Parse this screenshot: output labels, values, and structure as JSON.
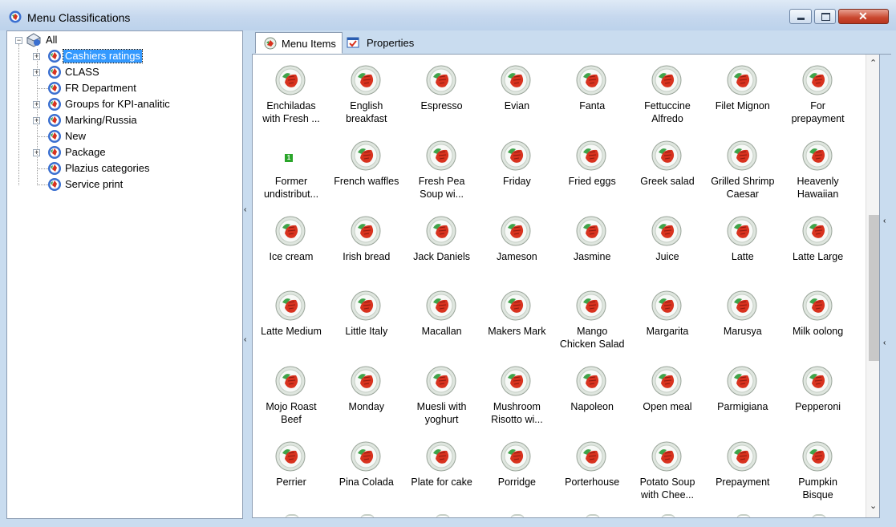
{
  "window": {
    "title": "Menu Classifications"
  },
  "tree": {
    "root": "All",
    "items": [
      {
        "label": "Cashiers ratings",
        "expandable": true,
        "selected": true
      },
      {
        "label": "CLASS",
        "expandable": true
      },
      {
        "label": "FR Department",
        "expandable": false
      },
      {
        "label": "Groups for KPI-analitic",
        "expandable": true
      },
      {
        "label": "Marking/Russia",
        "expandable": true
      },
      {
        "label": "New",
        "expandable": false
      },
      {
        "label": "Package",
        "expandable": true
      },
      {
        "label": "Plazius categories",
        "expandable": false
      },
      {
        "label": "Service print",
        "expandable": false
      }
    ]
  },
  "tabs": [
    {
      "label": "Menu Items",
      "active": true
    },
    {
      "label": "Properties",
      "active": false
    }
  ],
  "items": [
    {
      "label": "Enchiladas\nwith Fresh ..."
    },
    {
      "label": "English\nbreakfast"
    },
    {
      "label": "Espresso"
    },
    {
      "label": "Evian"
    },
    {
      "label": "Fanta"
    },
    {
      "label": "Fettuccine\nAlfredo"
    },
    {
      "label": "Filet Mignon"
    },
    {
      "label": "For\nprepayment"
    },
    {
      "label": "Former\nundistribut...",
      "noicon": true,
      "badge": "1"
    },
    {
      "label": "French waffles"
    },
    {
      "label": "Fresh Pea\nSoup wi..."
    },
    {
      "label": "Friday"
    },
    {
      "label": "Fried eggs"
    },
    {
      "label": "Greek salad"
    },
    {
      "label": "Grilled Shrimp\nCaesar"
    },
    {
      "label": "Heavenly\nHawaiian"
    },
    {
      "label": "Ice cream"
    },
    {
      "label": "Irish bread"
    },
    {
      "label": "Jack Daniels"
    },
    {
      "label": "Jameson"
    },
    {
      "label": "Jasmine"
    },
    {
      "label": "Juice"
    },
    {
      "label": "Latte"
    },
    {
      "label": "Latte Large"
    },
    {
      "label": "Latte Medium"
    },
    {
      "label": "Little Italy"
    },
    {
      "label": "Macallan"
    },
    {
      "label": "Makers Mark"
    },
    {
      "label": "Mango\nChicken Salad"
    },
    {
      "label": "Margarita"
    },
    {
      "label": "Marusya"
    },
    {
      "label": "Milk oolong"
    },
    {
      "label": "Mojo Roast\nBeef"
    },
    {
      "label": "Monday"
    },
    {
      "label": "Muesli with\nyoghurt"
    },
    {
      "label": "Mushroom\nRisotto wi..."
    },
    {
      "label": "Napoleon"
    },
    {
      "label": "Open meal"
    },
    {
      "label": "Parmigiana"
    },
    {
      "label": "Pepperoni"
    },
    {
      "label": "Perrier"
    },
    {
      "label": "Pina Colada"
    },
    {
      "label": "Plate for cake"
    },
    {
      "label": "Porridge"
    },
    {
      "label": "Porterhouse"
    },
    {
      "label": "Potato Soup\nwith Chee..."
    },
    {
      "label": "Prepayment"
    },
    {
      "label": "Pumpkin\nBisque"
    }
  ],
  "icons": {
    "app": "menu-classification-icon",
    "item": "menu-item-plate-icon",
    "tree_root": "classification-root-icon",
    "tree_node": "menu-group-icon"
  },
  "colors": {
    "window_bg": "#c9dcef",
    "selection": "#3399ff",
    "close_button": "#c9462e",
    "item_icon_red": "#d8321e",
    "item_icon_green": "#3fa34a"
  }
}
